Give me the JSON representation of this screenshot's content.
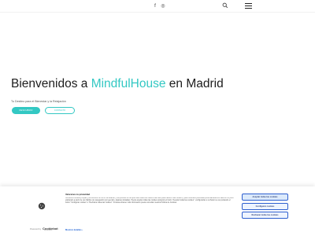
{
  "colors": {
    "accent": "#33c8c3",
    "cookie_link": "#1a5fd3",
    "cookie_button_border": "#2d5fcf"
  },
  "header": {
    "social_icons": [
      "facebook-icon",
      "instagram-icon"
    ],
    "facebook_glyph": "f",
    "instagram_glyph": "◎",
    "search_icon": "search-icon",
    "menu_icon": "menu-icon"
  },
  "hero": {
    "title_prefix": "Bienvenidos a ",
    "title_brand": "MindfulHouse",
    "title_suffix": " en Madrid",
    "subtitle": "Tu Destino para el Bienestar y la Relajación",
    "primary_button": "DESCUBRIR",
    "secondary_button": "CONTACTO"
  },
  "cookie_banner": {
    "title": "Valoramos tu privacidad",
    "text": "Utilizamos cookies propias y de terceros con el fin de analizar y comprender el uso que hace usted de nuestro sitio web para hacerlo más intuitivo y para mostrarle publicidad personalizada con base en un perfil elaborado a partir de sus hábitos de navegación (por ejemplo, páginas visitadas). Puede aceptar todas las cookies pulsando el botón \"Aceptar todas las cookies\", configurarlas o rechazar su uso pulsando el botón \"Configurar cookies\" o \"Rechazar todas las cookies\". Si desea obtener más información puede consultar nuestra Política de Cookies.",
    "more_details": "Mostrar detalles",
    "powered_by": "Powered by",
    "powered_brand": "Cookiebot",
    "powered_sub": "by Usercentrics",
    "accept_all": "Aceptar todas las cookies",
    "configure": "Configurar cookies",
    "reject_all": "Rechazar todas las cookies"
  }
}
